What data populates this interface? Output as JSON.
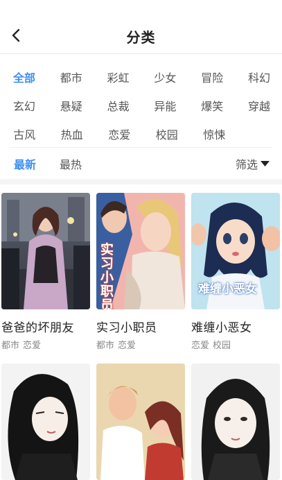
{
  "header": {
    "title": "分类"
  },
  "categories": [
    [
      "全部",
      "都市",
      "彩虹",
      "少女",
      "冒险",
      "科幻"
    ],
    [
      "玄幻",
      "悬疑",
      "总裁",
      "异能",
      "爆笑",
      "穿越"
    ],
    [
      "古风",
      "热血",
      "恋爱",
      "校园",
      "惊悚"
    ]
  ],
  "active_category": "全部",
  "sort": {
    "latest": "最新",
    "hottest": "最热",
    "filter": "筛选",
    "active": "最新"
  },
  "comics": [
    {
      "title": "爸爸的坏朋友",
      "tags": [
        "都市",
        "恋爱"
      ]
    },
    {
      "title": "实习小职员",
      "tags": [
        "都市",
        "恋爱"
      ],
      "cover_text": "实习小职员"
    },
    {
      "title": "难缠小恶女",
      "tags": [
        "恋爱",
        "校园"
      ],
      "cover_text": "难缠小恶女"
    },
    {
      "title": "",
      "tags": []
    },
    {
      "title": "",
      "tags": []
    },
    {
      "title": "",
      "tags": []
    }
  ],
  "colors": {
    "accent": "#3d8ff0",
    "text": "#555555",
    "tag": "#888888"
  }
}
